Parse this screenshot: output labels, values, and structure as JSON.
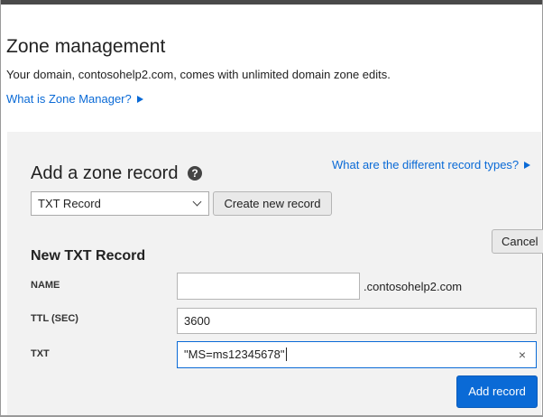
{
  "header": {
    "title": "Zone management",
    "description": "Your domain, contosohelp2.com, comes with unlimited domain zone edits.",
    "what_is_link": "What is Zone Manager?"
  },
  "add_record": {
    "title": "Add a zone record",
    "help_icon_glyph": "?",
    "record_types_link": "What are the different record types?",
    "record_type_selected": "TXT Record",
    "create_button": "Create new record",
    "cancel_button": "Cancel"
  },
  "form": {
    "section_title": "New TXT Record",
    "name_label": "NAME",
    "name_value": "",
    "domain_suffix": ".contosohelp2.com",
    "ttl_label": "TTL (SEC)",
    "ttl_value": "3600",
    "txt_label": "TXT",
    "txt_value": "\"MS=ms12345678\"",
    "clear_glyph": "×",
    "add_button": "Add record"
  },
  "colors": {
    "accent": "#0a6ad6",
    "panel_bg": "#f2f2f2"
  },
  "icons": {
    "help": "help-icon",
    "link_arrow": "triangle-right-icon",
    "dropdown": "chevron-down-icon",
    "clear": "close-icon"
  }
}
